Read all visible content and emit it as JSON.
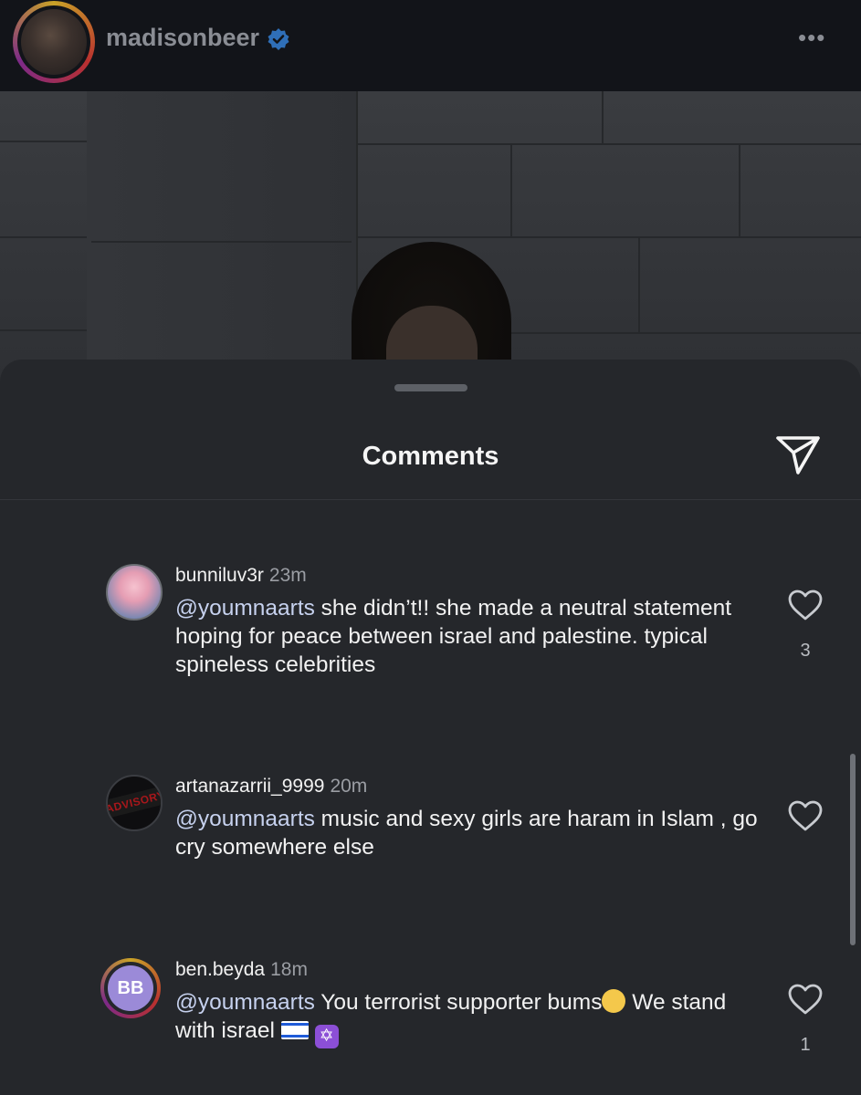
{
  "post": {
    "username": "madisonbeer",
    "verified_icon": "verified-badge-icon",
    "more_icon": "more-options-icon"
  },
  "sheet": {
    "title": "Comments",
    "share_icon": "send-icon"
  },
  "comments": [
    {
      "username": "bunniluv3r",
      "time": "23m",
      "mention": "@youmnaarts",
      "text": " she didn’t!! she made a neutral statement hoping for peace between israel and palestine. typical spineless celebrities",
      "likes": "3"
    },
    {
      "username": "artanazarrii_9999",
      "time": "20m",
      "mention": "@youmnaarts",
      "text": " music and sexy girls are haram in Islam , go cry somewhere else",
      "likes": ""
    },
    {
      "username": "ben.beyda",
      "time": "18m",
      "avatar_initials": "BB",
      "mention": "@youmnaarts",
      "text": " You terrorist supporter bums",
      "text_after_emoji": " We stand with israel ",
      "likes": "1"
    }
  ],
  "colors": {
    "sheet_background": "#25272b",
    "mention": "#c6d1ee",
    "muted": "#9a9da3",
    "verified": "#3797f0"
  }
}
